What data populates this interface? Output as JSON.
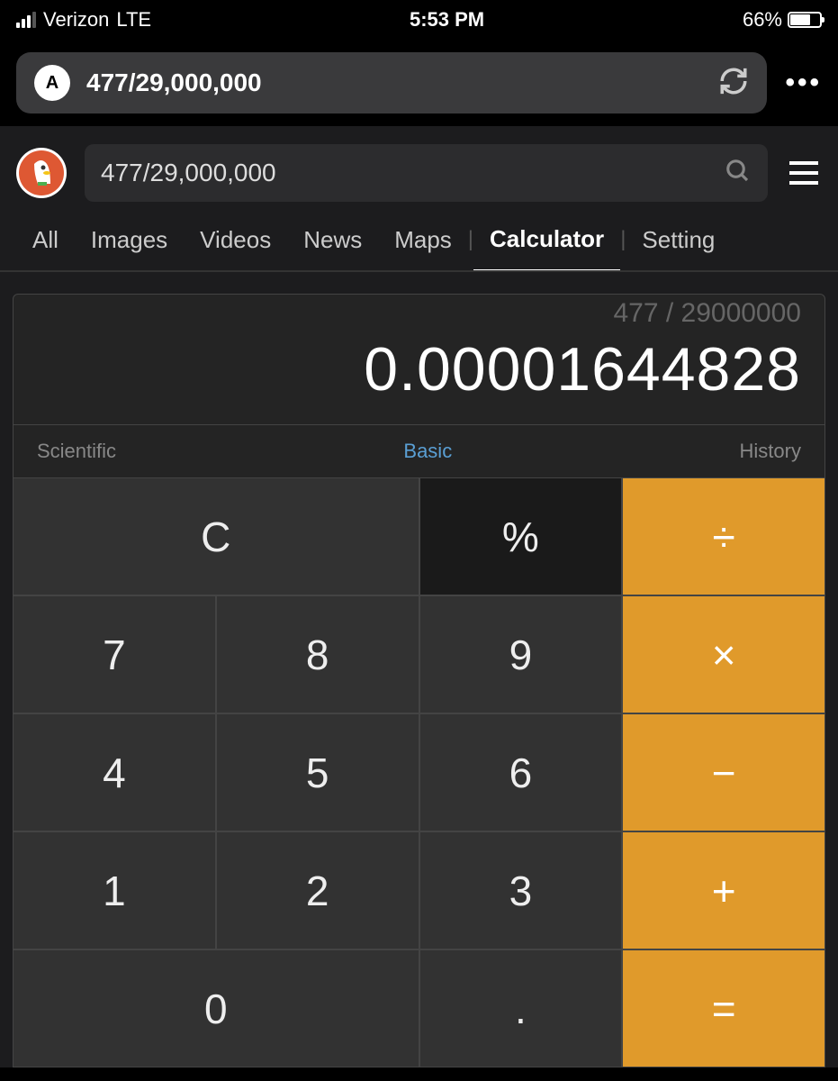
{
  "status": {
    "carrier": "Verizon",
    "network": "LTE",
    "time": "5:53 PM",
    "battery_pct": "66%"
  },
  "url_bar": {
    "aa_label": "A",
    "url": "477/29,000,000"
  },
  "search": {
    "query": "477/29,000,000"
  },
  "tabs": {
    "all": "All",
    "images": "Images",
    "videos": "Videos",
    "news": "News",
    "maps": "Maps",
    "calculator": "Calculator",
    "settings": "Setting"
  },
  "calc": {
    "expression": "477 / 29000000",
    "result": "0.00001644828",
    "modes": {
      "scientific": "Scientific",
      "basic": "Basic",
      "history": "History"
    },
    "buttons": {
      "clear": "C",
      "percent": "%",
      "divide": "÷",
      "seven": "7",
      "eight": "8",
      "nine": "9",
      "multiply": "×",
      "four": "4",
      "five": "5",
      "six": "6",
      "minus": "−",
      "one": "1",
      "two": "2",
      "three": "3",
      "plus": "+",
      "zero": "0",
      "decimal": ".",
      "equals": "="
    }
  }
}
